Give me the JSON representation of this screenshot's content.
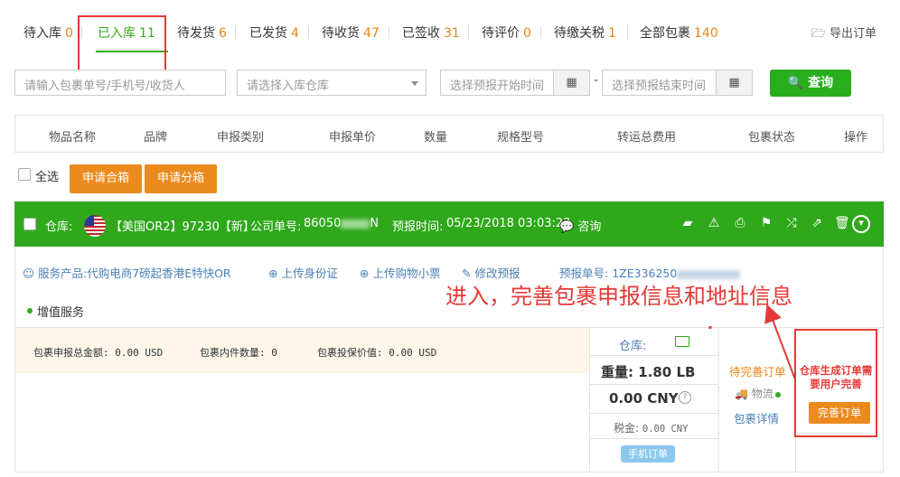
{
  "tabs": [
    {
      "label": "待入库",
      "count": "0"
    },
    {
      "label": "已入库",
      "count": "11"
    },
    {
      "label": "待发货",
      "count": "6"
    },
    {
      "label": "已发货",
      "count": "4"
    },
    {
      "label": "待收货",
      "count": "47"
    },
    {
      "label": "已签收",
      "count": "31"
    },
    {
      "label": "待评价",
      "count": "0"
    },
    {
      "label": "待缴关税",
      "count": "1"
    },
    {
      "label": "全部包裹",
      "count": "140"
    }
  ],
  "export_label": "导出订单",
  "filters": {
    "search_placeholder": "请输入包裹单号/手机号/收货人",
    "warehouse_placeholder": "请选择入库仓库",
    "start_placeholder": "选择预报开始时间",
    "end_placeholder": "选择预报结束时间",
    "range_sep": "-",
    "search_button": "查询"
  },
  "columns": [
    "物品名称",
    "品牌",
    "申报类别",
    "申报单价",
    "数量",
    "规格型号",
    "转运总费用",
    "包裹状态",
    "操作"
  ],
  "actions": {
    "select_all": "全选",
    "merge": "申请合箱",
    "split": "申请分箱"
  },
  "package": {
    "warehouse_label": "仓库:",
    "warehouse_name": "【美国OR2】97230【新】",
    "company_no_label": "公司单号:",
    "company_no_prefix": "86050",
    "company_no_suffix": "N",
    "forecast_time_label": "预报时间:",
    "forecast_time": "05/23/2018 03:03:23",
    "consult": "咨询",
    "service_label": "服务产品:",
    "service_value": "代购电商7磅起香港E特快OR",
    "upload_id": "上传身份证",
    "upload_receipt": "上传购物小票",
    "edit_forecast": "修改预报",
    "forecast_no_label": "预报单号:",
    "forecast_no_prefix": "1ZE336250",
    "added_service": "增值服务",
    "declared_total": "包裹申报总金额: 0.00 USD",
    "item_count": "包裹内件数量: 0",
    "insured_value": "包裹投保价值: 0.00 USD",
    "warehouse_short": "仓库:",
    "weight": "重量: 1.80 LB",
    "price": "0.00 CNY",
    "tax_label": "税金:",
    "tax_value": "0.00 CNY",
    "mobile_order": "手机订单",
    "status": "待完善订单",
    "logistics": "物流",
    "package_detail": "包裹详情",
    "complete_button": "完善订单"
  },
  "annotations": {
    "main": "进入，完善包裹申报信息和地址信息",
    "note": "仓库生成订单需要用户完善"
  }
}
